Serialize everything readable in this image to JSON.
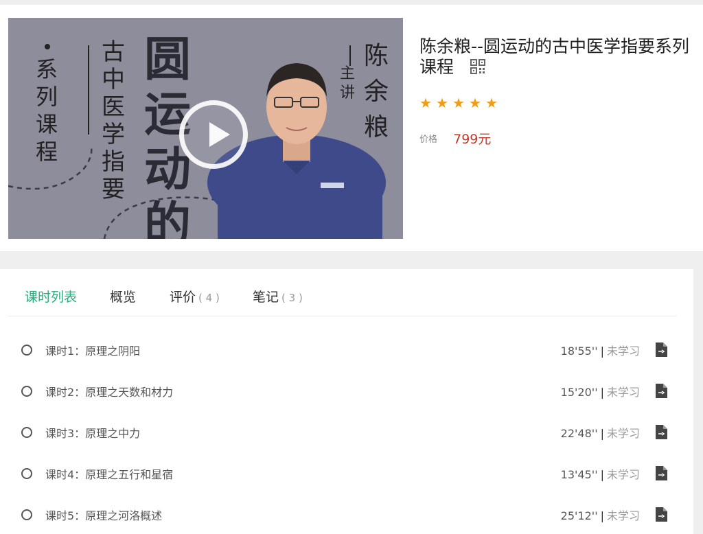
{
  "course": {
    "title": "陈余粮--圆运动的古中医学指要系列课程",
    "rating_stars": 5,
    "price_label": "价格",
    "price_value": "799元"
  },
  "cover": {
    "series_label": "系列课程",
    "subtitle": "古中医学指要",
    "main_title": "圆运动的",
    "lecturer_tag": "主讲",
    "lecturer_name": "陈余粮"
  },
  "tabs": [
    {
      "label": "课时列表",
      "count": ""
    },
    {
      "label": "概览",
      "count": ""
    },
    {
      "label": "评价",
      "count": "( 4 )"
    },
    {
      "label": "笔记",
      "count": "( 3 )"
    }
  ],
  "lessons": [
    {
      "name": "课时1：原理之阴阳",
      "duration": "18'55''",
      "status": "未学习"
    },
    {
      "name": "课时2：原理之天数和材力",
      "duration": "15'20''",
      "status": "未学习"
    },
    {
      "name": "课时3：原理之中力",
      "duration": "22'48''",
      "status": "未学习"
    },
    {
      "name": "课时4：原理之五行和星宿",
      "duration": "13'45''",
      "status": "未学习"
    },
    {
      "name": "课时5：原理之河洛概述",
      "duration": "25'12''",
      "status": "未学习"
    }
  ],
  "colors": {
    "accent": "#27ae7a",
    "price": "#c0392b",
    "star": "#f39c12",
    "cover_bg": "#8e8d9c"
  }
}
